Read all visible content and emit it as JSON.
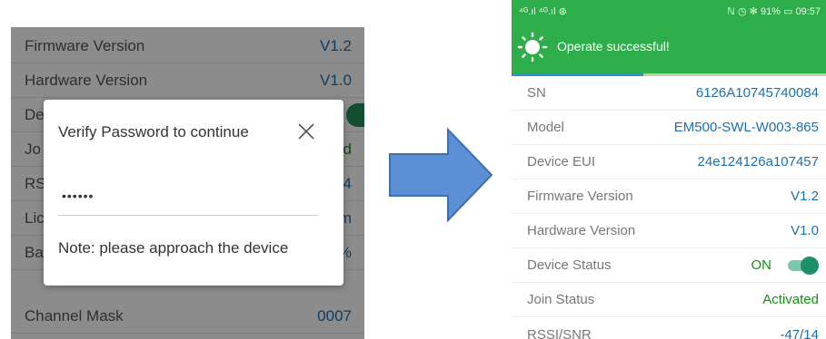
{
  "left_panel": {
    "rows": [
      {
        "label": "Firmware Version",
        "value": "V1.2"
      },
      {
        "label": "Hardware Version",
        "value": "V1.0"
      },
      {
        "label": "De",
        "value": ""
      },
      {
        "label": "Jo",
        "value": "ed"
      },
      {
        "label": "RS",
        "value": "14"
      },
      {
        "label": "Lic",
        "value": "m"
      },
      {
        "label": "Ba",
        "value": "%"
      },
      {
        "label": "Channel Mask",
        "value": "0007"
      }
    ],
    "dialog": {
      "title": "Verify Password to continue",
      "password_value": "••••••",
      "note": "Note: please approach the device"
    }
  },
  "right_panel": {
    "status_bar": {
      "left": "⁴ᴳ.ıl ⁴ᴳ.ıl ⊛",
      "right": "ℕ ◷ ✻ 91% ▭ 09:57"
    },
    "toast": "Operate successful!",
    "progress": 0.42,
    "colors": {
      "header": "#2eae4b",
      "value_blue": "#1a6fb0",
      "value_green": "#1a8a1a",
      "toggle": "#1d8f6a"
    },
    "rows": [
      {
        "label": "SN",
        "value": "6126A10745740084"
      },
      {
        "label": "Model",
        "value": "EM500-SWL-W003-865"
      },
      {
        "label": "Device EUI",
        "value": "24e124126a107457"
      },
      {
        "label": "Firmware Version",
        "value": "V1.2"
      },
      {
        "label": "Hardware Version",
        "value": "V1.0"
      },
      {
        "label": "Device Status",
        "value": "ON",
        "toggle_on": true
      },
      {
        "label": "Join Status",
        "value": "Activated"
      },
      {
        "label": "RSSI/SNR",
        "value": "-47/14"
      }
    ]
  }
}
